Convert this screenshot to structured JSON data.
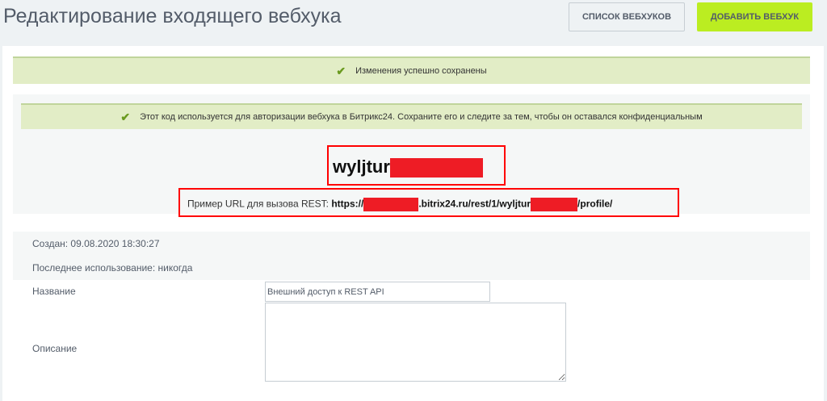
{
  "header": {
    "title": "Редактирование входящего вебхука",
    "list_button": "Список вебхуков",
    "add_button": "Добавить вебхук"
  },
  "success_message": "Изменения успешно сохранены",
  "info_message": "Этот код используется для авторизации вебхука в Битрикс24. Сохраните его и следите за тем, чтобы он оставался конфиденциальным",
  "token_prefix": "wyljtur",
  "url": {
    "label": "Пример URL для вызова REST:",
    "part1": "https://",
    "part2": ".bitrix24.ru/rest/1/wyljtur",
    "part3": "/profile/"
  },
  "meta": {
    "created": "Создан: 09.08.2020 18:30:27",
    "last_used": "Последнее использование: никогда"
  },
  "form": {
    "name_label": "Название",
    "name_value": "Внешний доступ к REST API",
    "description_label": "Описание",
    "description_value": ""
  },
  "colors": {
    "accent": "#bbed21",
    "success_bg": "#e2edc6",
    "redaction": "#ee1c25"
  }
}
